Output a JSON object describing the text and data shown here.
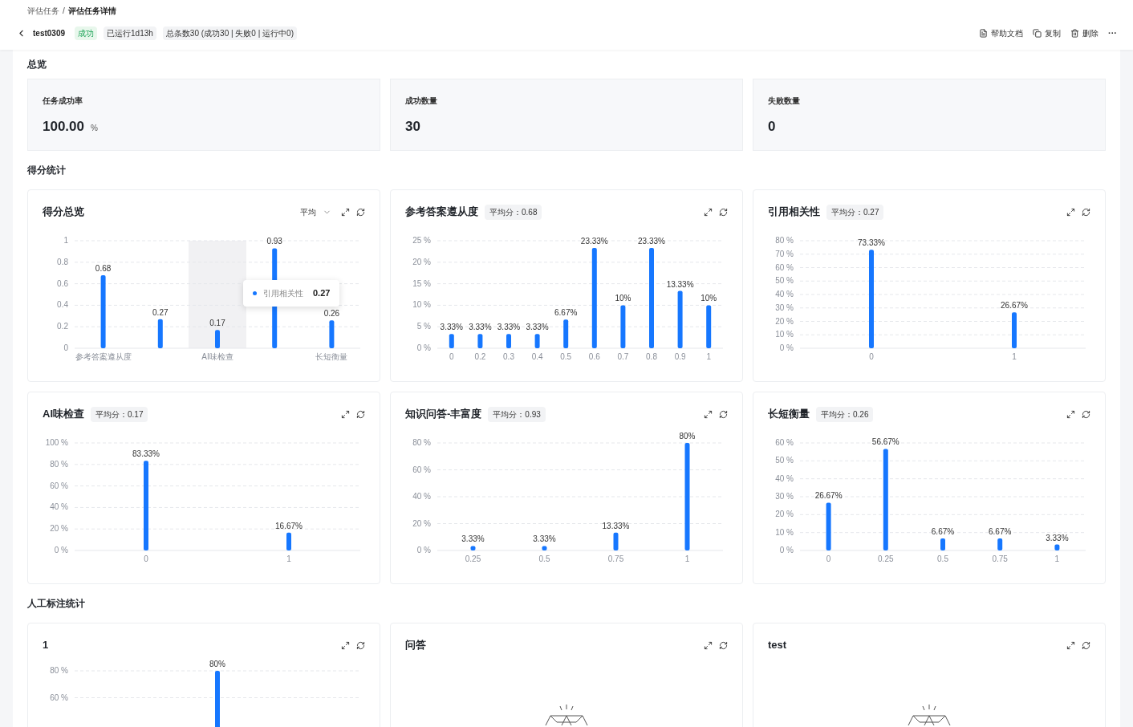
{
  "breadcrumb": [
    "评估任务",
    "评估任务详情"
  ],
  "breadcrumb_separator": "/",
  "header": {
    "title": "test0309",
    "status": {
      "label": "成功",
      "kind": "success"
    },
    "tags": [
      "已运行1d13h",
      "总条数30 (成功30 | 失败0 | 运行中0)"
    ],
    "actions": [
      {
        "kind": "doc",
        "label": "帮助文档"
      },
      {
        "kind": "copy",
        "label": "复制"
      },
      {
        "kind": "delete",
        "label": "删除"
      }
    ],
    "more": "···"
  },
  "overview": {
    "title": "总览",
    "stats": [
      {
        "label": "任务成功率",
        "value": "100.00",
        "unit": "%"
      },
      {
        "label": "成功数量",
        "value": "30"
      },
      {
        "label": "失败数量",
        "value": "0"
      }
    ]
  },
  "score_section": {
    "title": "得分统计",
    "cards": [
      {
        "title": "得分总览",
        "select": "平均",
        "hovered": [
          false,
          false,
          true,
          false,
          false
        ],
        "tooltip": {
          "label": "引用相关性",
          "value": "0.27"
        },
        "chart_data": {
          "type": "bar",
          "grid": true,
          "categories": [
            "参考答案遵从度",
            null,
            "AI味检查",
            null,
            "长短衡量"
          ],
          "values": [
            0.68,
            0.27,
            0.17,
            0.93,
            0.26
          ],
          "ylim": [
            0,
            1
          ],
          "yticks": [
            {
              "value": 0,
              "label": "0"
            },
            {
              "value": 0.2,
              "label": "0.2"
            },
            {
              "value": 0.4,
              "label": "0.4"
            },
            {
              "value": 0.6,
              "label": "0.6"
            },
            {
              "value": 0.8,
              "label": "0.8"
            },
            {
              "value": 1,
              "label": "1"
            }
          ],
          "value_labels": [
            "0.68",
            "0.27",
            "0.17",
            "0.93",
            "0.26"
          ]
        }
      },
      {
        "title": "参考答案遵从度",
        "badge": "平均分：0.68",
        "chart_data": {
          "type": "bar",
          "grid": true,
          "categories": [
            "0",
            "0.2",
            "0.3",
            "0.4",
            "0.5",
            "0.6",
            "0.7",
            "0.8",
            "0.9",
            "1"
          ],
          "values": [
            3.33,
            3.33,
            3.33,
            3.33,
            6.67,
            23.33,
            10,
            23.33,
            13.33,
            10
          ],
          "ylim": [
            0,
            25
          ],
          "yticks": [
            {
              "value": 0,
              "label": "0 %"
            },
            {
              "value": 5,
              "label": "5 %"
            },
            {
              "value": 10,
              "label": "10 %"
            },
            {
              "value": 15,
              "label": "15 %"
            },
            {
              "value": 20,
              "label": "20 %"
            },
            {
              "value": 25,
              "label": "25 %"
            }
          ],
          "value_labels": [
            "3.33%",
            "3.33%",
            "3.33%",
            "3.33%",
            "6.67%",
            "23.33%",
            "10%",
            "23.33%",
            "13.33%",
            "10%"
          ]
        }
      },
      {
        "title": "引用相关性",
        "badge": "平均分：0.27",
        "chart_data": {
          "type": "bar",
          "grid": true,
          "categories": [
            "0",
            "1"
          ],
          "values": [
            73.33,
            26.67
          ],
          "ylim": [
            0,
            80
          ],
          "yticks": [
            {
              "value": 0,
              "label": "0 %"
            },
            {
              "value": 10,
              "label": "10 %"
            },
            {
              "value": 20,
              "label": "20 %"
            },
            {
              "value": 30,
              "label": "30 %"
            },
            {
              "value": 40,
              "label": "40 %"
            },
            {
              "value": 50,
              "label": "50 %"
            },
            {
              "value": 60,
              "label": "60 %"
            },
            {
              "value": 70,
              "label": "70 %"
            },
            {
              "value": 80,
              "label": "80 %"
            }
          ],
          "value_labels": [
            "73.33%",
            "26.67%"
          ]
        }
      },
      {
        "title": "AI味检查",
        "badge": "平均分：0.17",
        "chart_data": {
          "type": "bar",
          "grid": true,
          "categories": [
            "0",
            "1"
          ],
          "values": [
            83.33,
            16.67
          ],
          "ylim": [
            0,
            100
          ],
          "yticks": [
            {
              "value": 0,
              "label": "0 %"
            },
            {
              "value": 20,
              "label": "20 %"
            },
            {
              "value": 40,
              "label": "40 %"
            },
            {
              "value": 60,
              "label": "60 %"
            },
            {
              "value": 80,
              "label": "80 %"
            },
            {
              "value": 100,
              "label": "100 %"
            }
          ],
          "value_labels": [
            "83.33%",
            "16.67%"
          ]
        }
      },
      {
        "title": "知识问答-丰富度",
        "badge": "平均分：0.93",
        "chart_data": {
          "type": "bar",
          "grid": true,
          "categories": [
            "0.25",
            "0.5",
            "0.75",
            "1"
          ],
          "values": [
            3.33,
            3.33,
            13.33,
            80
          ],
          "ylim": [
            0,
            80
          ],
          "yticks": [
            {
              "value": 0,
              "label": "0 %"
            },
            {
              "value": 20,
              "label": "20 %"
            },
            {
              "value": 40,
              "label": "40 %"
            },
            {
              "value": 60,
              "label": "60 %"
            },
            {
              "value": 80,
              "label": "80 %"
            }
          ],
          "value_labels": [
            "3.33%",
            "3.33%",
            "13.33%",
            "80%"
          ]
        }
      },
      {
        "title": "长短衡量",
        "badge": "平均分：0.26",
        "chart_data": {
          "type": "bar",
          "grid": true,
          "categories": [
            "0",
            "0.25",
            "0.5",
            "0.75",
            "1"
          ],
          "values": [
            26.67,
            56.67,
            6.67,
            6.67,
            3.33
          ],
          "ylim": [
            0,
            60
          ],
          "yticks": [
            {
              "value": 0,
              "label": "0 %"
            },
            {
              "value": 10,
              "label": "10 %"
            },
            {
              "value": 20,
              "label": "20 %"
            },
            {
              "value": 30,
              "label": "30 %"
            },
            {
              "value": 40,
              "label": "40 %"
            },
            {
              "value": 50,
              "label": "50 %"
            },
            {
              "value": 60,
              "label": "60 %"
            }
          ],
          "value_labels": [
            "26.67%",
            "56.67%",
            "6.67%",
            "6.67%",
            "3.33%"
          ]
        }
      }
    ]
  },
  "manual_section": {
    "title": "人工标注统计",
    "cards": [
      {
        "title": "1",
        "kind": "chart",
        "chart_data": {
          "type": "bar",
          "grid": true,
          "values": [
            80
          ],
          "ylim": [
            0,
            80
          ],
          "yticks": [
            {
              "value": 60,
              "label": "60 %"
            },
            {
              "value": 80,
              "label": "80 %"
            }
          ],
          "value_labels": [
            "80%"
          ]
        }
      },
      {
        "title": "问答",
        "kind": "empty"
      },
      {
        "title": "test",
        "kind": "empty"
      }
    ]
  }
}
